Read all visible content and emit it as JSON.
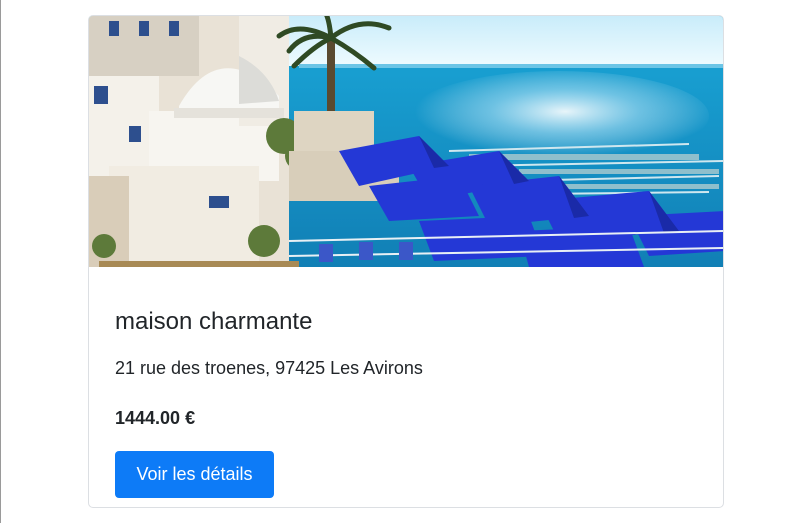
{
  "listing": {
    "title": "maison charmante",
    "address": "21 rue des troenes, 97425 Les Avirons",
    "price": "1444.00 €",
    "details_button_label": "Voir les détails",
    "image_alt": "vue sur la mer"
  },
  "colors": {
    "button_bg": "#0d7bf7",
    "text": "#212529",
    "card_border": "#dcdfe3",
    "sea": "#1f9bd1",
    "umbrella_blue": "#2438d6",
    "sky": "#dff4fc"
  }
}
